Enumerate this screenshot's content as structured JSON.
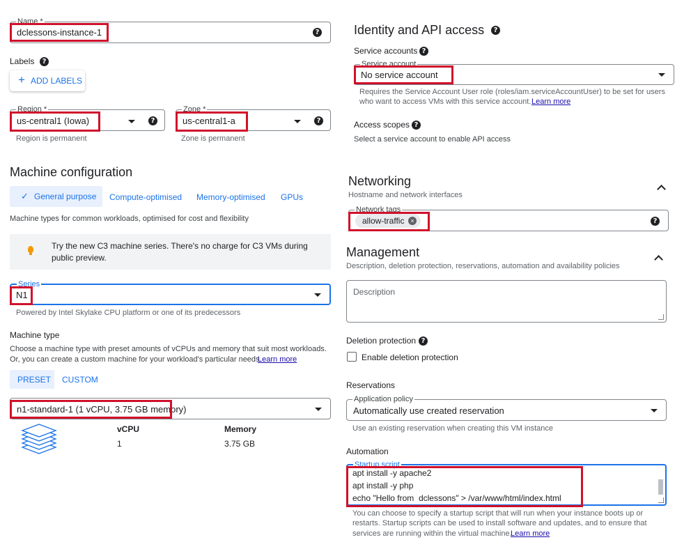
{
  "name": {
    "label": "Name *",
    "value": "dclessons-instance-1"
  },
  "labels": {
    "title": "Labels",
    "add_button": "ADD LABELS"
  },
  "region": {
    "label": "Region *",
    "value": "us-central1 (Iowa)",
    "hint": "Region is permanent"
  },
  "zone": {
    "label": "Zone *",
    "value": "us-central1-a",
    "hint": "Zone is permanent"
  },
  "machine_config": {
    "title": "Machine configuration",
    "tabs": [
      "General purpose",
      "Compute-optimised",
      "Memory-optimised",
      "GPUs"
    ],
    "tab_note": "Machine types for common workloads, optimised for cost and flexibility",
    "info_banner": "Try the new C3 machine series. There's no charge for C3 VMs during public preview.",
    "series_label": "Series",
    "series_value": "N1",
    "series_hint": "Powered by Intel Skylake CPU platform or one of its predecessors",
    "machine_type_title": "Machine type",
    "machine_type_desc_1": "Choose a machine type with preset amounts of vCPUs and memory that suit most workloads.",
    "machine_type_desc_2": "Or, you can create a custom machine for your workload's particular needs.",
    "learn_more": "Learn more",
    "preset": "PRESET",
    "custom": "CUSTOM",
    "machine_value": "n1-standard-1 (1 vCPU, 3.75 GB memory)",
    "vcpu_header": "vCPU",
    "vcpu_value": "1",
    "memory_header": "Memory",
    "memory_value": "3.75 GB"
  },
  "identity": {
    "title": "Identity and API access",
    "sa_title": "Service accounts",
    "sa_label": "Service account",
    "sa_value": "No service account",
    "sa_note_1": "Requires the Service Account User role (roles/iam.serviceAccountUser) to be set for users",
    "sa_note_2": "who want to access VMs with this service account.",
    "learn_more": "Learn more",
    "scopes_title": "Access scopes",
    "scopes_note": "Select a service account to enable API access"
  },
  "networking": {
    "title": "Networking",
    "subtitle": "Hostname and network interfaces",
    "tags_label": "Network tags",
    "tag": "allow-traffic"
  },
  "management": {
    "title": "Management",
    "subtitle": "Description, deletion protection, reservations, automation and availability policies",
    "description_placeholder": "Description",
    "deletion_title": "Deletion protection",
    "deletion_checkbox": "Enable deletion protection",
    "reservations_title": "Reservations",
    "policy_label": "Application policy",
    "policy_value": "Automatically use created reservation",
    "policy_note": "Use an existing reservation when creating this VM instance",
    "automation_title": "Automation",
    "startup_label": "Startup script",
    "script_lines": [
      "apt install -y apache2",
      "apt install -y php",
      "echo \"Hello from  dclessons\" > /var/www/html/index.html"
    ],
    "startup_note_1": "You can choose to specify a startup script that will run when your instance boots up or",
    "startup_note_2": "restarts. Startup scripts can be used to install software and updates, and to ensure that",
    "startup_note_3": "services are running within the virtual machine.",
    "learn_more": "Learn more"
  },
  "icons": [
    "help-icon",
    "plus-icon",
    "caret-down-icon",
    "check-icon",
    "lightbulb-icon",
    "chevron-up-icon",
    "clear-icon",
    "stack-icon",
    "resize-icon"
  ],
  "colors": {
    "accent": "#1a73e8",
    "highlight": "#d0112b",
    "tab_bg": "#e8f0fe",
    "banner_bg": "#f1f3f4"
  }
}
